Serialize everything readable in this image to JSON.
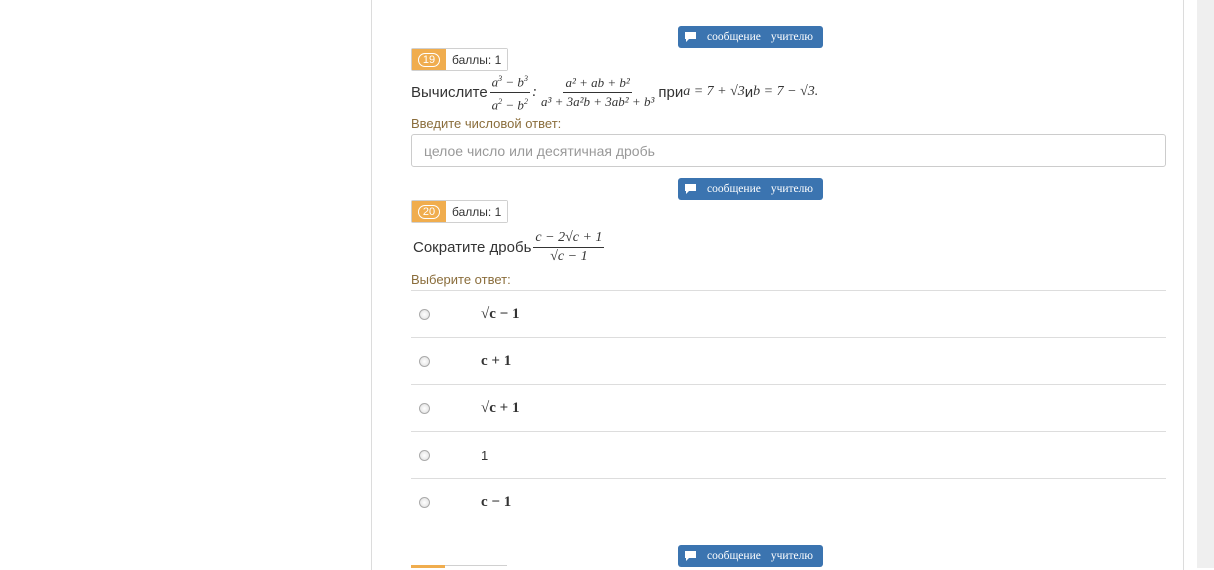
{
  "message_button": {
    "word1": "сообщение",
    "word2": "учителю",
    "icon": "chat-bubble-icon"
  },
  "q19": {
    "number": "19",
    "points": "баллы: 1",
    "prefix": "Вычислите",
    "frac1_num_a": "a",
    "frac1_num_e1": "3",
    "frac1_num_mid": " − b",
    "frac1_num_e2": "3",
    "frac1_den_a": "a",
    "frac1_den_e1": "2",
    "frac1_den_mid": " − b",
    "frac1_den_e2": "2",
    "colon": " : ",
    "frac2_num": "a² + ab + b²",
    "frac2_den": "a³ + 3a²b + 3ab² + b³",
    "condition_pre": " при ",
    "condition_a": "a = 7 + √3",
    "condition_and": " и ",
    "condition_b": "b = 7 − √3.",
    "answer_label": "Введите числовой ответ:",
    "input_placeholder": "целое число или десятичная дробь",
    "input_value": ""
  },
  "q20": {
    "number": "20",
    "points": "баллы: 1",
    "prefix": "Сократите дробь",
    "frac_num": "c − 2√c + 1",
    "frac_den": "√c − 1",
    "answer_label": "Выберите ответ:",
    "options": [
      "√c − 1",
      "c + 1",
      "√c + 1",
      "1",
      "c − 1"
    ]
  }
}
